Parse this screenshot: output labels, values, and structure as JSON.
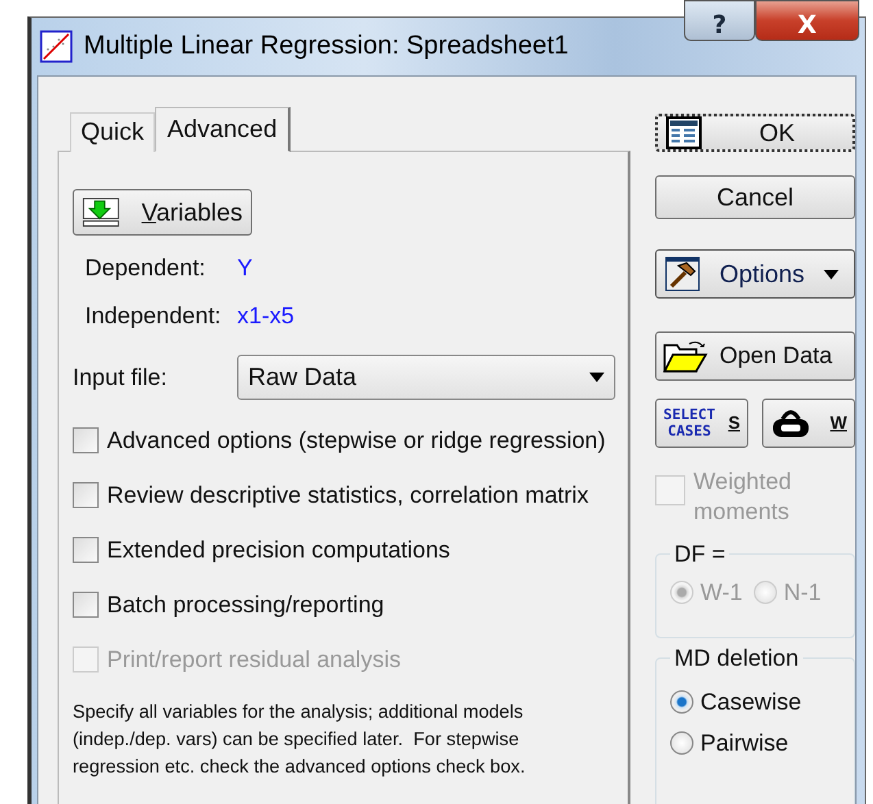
{
  "window": {
    "title": "Multiple Linear Regression: Spreadsheet1",
    "help": "?",
    "close": "X"
  },
  "tabs": [
    {
      "label": "Quick",
      "selected": false
    },
    {
      "label": "Advanced",
      "selected": true
    }
  ],
  "variables_button": {
    "label": "Variables"
  },
  "dependent": {
    "label": "Dependent:",
    "value": "Y"
  },
  "independent": {
    "label": "Independent:",
    "value": "x1-x5"
  },
  "input_file": {
    "label": "Input file:",
    "value": "Raw Data"
  },
  "checkboxes": [
    {
      "label": "Advanced options (stepwise or ridge regression)",
      "checked": false,
      "disabled": false
    },
    {
      "label": "Review descriptive statistics, correlation matrix",
      "checked": false,
      "disabled": false
    },
    {
      "label": "Extended precision computations",
      "checked": false,
      "disabled": false
    },
    {
      "label": "Batch processing/reporting",
      "checked": false,
      "disabled": false
    },
    {
      "label": "Print/report residual analysis",
      "checked": false,
      "disabled": true
    }
  ],
  "note": "Specify all variables for the analysis; additional models (indep./dep. vars) can be specified later.  For stepwise regression etc. check the advanced options check box.",
  "buttons": [
    {
      "kind": "ok",
      "label": "OK"
    },
    {
      "kind": "cancel",
      "label": "Cancel"
    },
    {
      "kind": "options",
      "label": "Options"
    },
    {
      "kind": "open",
      "label": "Open Data"
    }
  ],
  "select_cases": {
    "icon_lines": [
      "SELECT",
      "CASES"
    ],
    "key": "S"
  },
  "weight_button": {
    "key": "W"
  },
  "weighted_moments": {
    "label": "Weighted moments",
    "checked": false,
    "disabled": true
  },
  "df": {
    "title": "DF =",
    "disabled": true,
    "options": [
      {
        "label": "W-1",
        "selected": true
      },
      {
        "label": "N-1",
        "selected": false
      }
    ]
  },
  "md_deletion": {
    "title": "MD deletion",
    "disabled": false,
    "options": [
      {
        "label": "Casewise",
        "selected": true
      },
      {
        "label": "Pairwise",
        "selected": false
      }
    ]
  }
}
